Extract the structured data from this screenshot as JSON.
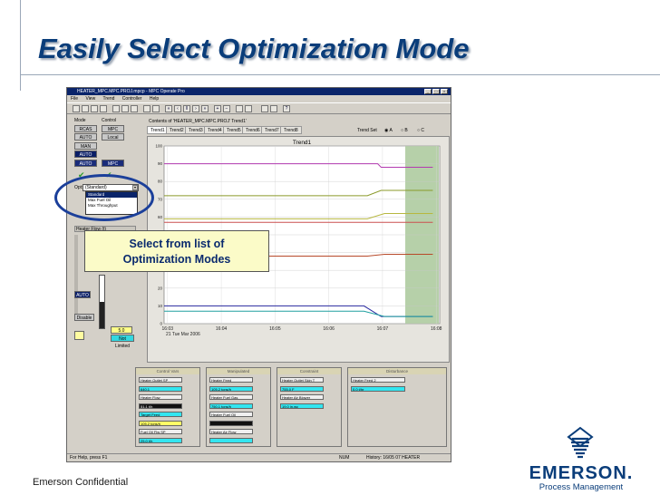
{
  "slide": {
    "title": "Easily Select Optimization Mode",
    "footer": "Emerson Confidential",
    "callout_line1": "Select from list of",
    "callout_line2": "Optimization Modes"
  },
  "logo": {
    "word": "EMERSON.",
    "sub": "Process Management",
    "icon": "emerson-stripes-icon"
  },
  "app": {
    "title": "HEATER_MPC.MPC.PROJ.mpcp - MPC Operate Pro",
    "menu": [
      "File",
      "View",
      "Trend",
      "Controller",
      "Help"
    ],
    "mode": {
      "mode_label": "Mode",
      "control_label": "Control",
      "rcas": "RCAS",
      "mpc": "MPC",
      "auto1": "AUTO",
      "local": "Local",
      "man": "MAN",
      "auto2": "AUTO",
      "auto3": "AUTO",
      "mpc_sel": "MPC"
    },
    "opt_label": "Opt:",
    "dropdown": {
      "selected": "(Standard)",
      "options": [
        "Standard",
        "Max Fuel Oil",
        "Max Throughput"
      ]
    },
    "heater_label": "Heater Flow (t)",
    "side_auto": "AUTO",
    "side_disable": "Disable",
    "value_box": "5.0",
    "not_limited": "Not Limited",
    "status_left": "For Help, press F1",
    "status_mid": "NUM",
    "status_right": "History: 16/05 07 HEATER"
  },
  "trend": {
    "contents_label": "Contents of 'HEATER_MPC.MPC.PROJ' Trend1'",
    "tabs": [
      "Trend1",
      "Trend2",
      "Trend3",
      "Trend4",
      "Trend5",
      "Trend6",
      "Trend7",
      "Trend8"
    ],
    "trend_set": "Trend Set",
    "trend_set_opts": [
      "A",
      "B",
      "C"
    ]
  },
  "chart_data": {
    "type": "line",
    "title": "Trend1",
    "xlabel": "",
    "ylabel": "",
    "x_ticks": [
      "16:03",
      "16:04",
      "16:05",
      "16:06",
      "16:07",
      "16:08"
    ],
    "date_label": "21 Tue Mar 2006",
    "y_ticks": [
      0,
      10,
      20,
      30,
      40,
      50,
      60,
      70,
      80,
      90,
      100
    ],
    "ylim": [
      0,
      100
    ],
    "grid": true,
    "highlight_start": "16:06.5",
    "series": [
      {
        "color": "#b33ab0",
        "x": [
          0,
          3.1,
          3.15,
          3.9
        ],
        "values": [
          90,
          90,
          88,
          88
        ]
      },
      {
        "color": "#8b9a2a",
        "x": [
          0,
          2.95,
          3.15,
          3.9
        ],
        "values": [
          72,
          72,
          75,
          75
        ]
      },
      {
        "color": "#b8b840",
        "x": [
          0,
          2.95,
          3.2,
          3.9
        ],
        "values": [
          59,
          59,
          62,
          62
        ]
      },
      {
        "color": "#b84a2a",
        "x": [
          0,
          2.95,
          3.2,
          3.9
        ],
        "values": [
          38,
          38,
          39,
          39
        ]
      },
      {
        "color": "#cc5050",
        "x": [
          0,
          3.9
        ],
        "values": [
          57,
          57
        ]
      },
      {
        "color": "#2a2aa0",
        "x": [
          0,
          2.9,
          3.15,
          3.9
        ],
        "values": [
          10,
          10,
          4,
          4
        ]
      },
      {
        "color": "#20a0a0",
        "x": [
          0,
          2.9,
          3.2,
          3.9
        ],
        "values": [
          7,
          7,
          4,
          4
        ]
      }
    ]
  },
  "tiles": [
    {
      "title": "Control Vars",
      "items": [
        {
          "label": "Heater Outlet  SP",
          "style": "w"
        },
        {
          "label": "640.1",
          "style": "c"
        },
        {
          "label": "Heater Flow",
          "style": "w"
        },
        {
          "label": "51.1 t/h",
          "style": "b"
        },
        {
          "label": "Target Feed",
          "style": "c"
        },
        {
          "label": "105.2 tons/h",
          "style": "y"
        },
        {
          "label": "Fuel Oil Flw  SP",
          "style": "w"
        },
        {
          "label": "25.0 t/h",
          "style": "c"
        }
      ]
    },
    {
      "title": "Manipulated",
      "items": [
        {
          "label": "Heater Feed",
          "style": "w"
        },
        {
          "label": "105.2 tons/h",
          "style": "c"
        },
        {
          "label": "Heater Fuel Gas",
          "style": "w"
        },
        {
          "label": "750.1 tons/h",
          "style": "c"
        },
        {
          "label": "Heater Fuel Oil",
          "style": "w"
        },
        {
          "label": "",
          "style": "b"
        },
        {
          "label": "Heater Air Flow",
          "style": "w"
        },
        {
          "label": "",
          "style": "c"
        }
      ]
    },
    {
      "title": "Constraint",
      "items": [
        {
          "label": "Heater Outlet Skin T",
          "style": "w"
        },
        {
          "label": "755.0 F",
          "style": "c"
        },
        {
          "label": "Heater Air Blower",
          "style": "w"
        },
        {
          "label": "19.0 in.wc",
          "style": "c"
        }
      ]
    },
    {
      "title": "Disturbance",
      "items": [
        {
          "label": "Heater Feed 2",
          "style": "w"
        },
        {
          "label": "0.0 t/hr",
          "style": "c"
        }
      ]
    }
  ]
}
